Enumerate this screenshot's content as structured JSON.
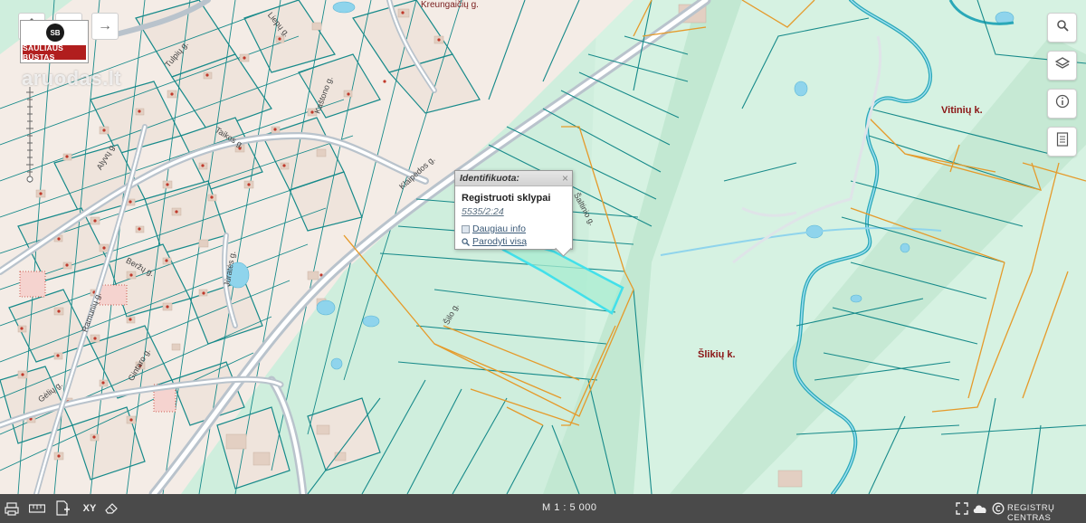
{
  "map": {
    "scale": "M 1 : 5 000",
    "colors": {
      "background": "#cfeedd",
      "parcel_line": "#178a8a",
      "registered_parcel": "#e59a2a",
      "road": "#b9c3cc",
      "water": "#8fd4ec",
      "building": "#e9d9cf",
      "highlight": "#6fe6e6"
    },
    "streets": [
      {
        "name": "Kreungaičių g."
      },
      {
        "name": "Taikos g."
      },
      {
        "name": "Klaipėdos g."
      },
      {
        "name": "Beržų g."
      },
      {
        "name": "Gintaro g."
      },
      {
        "name": "Gėlių g."
      },
      {
        "name": "Jūratės g."
      },
      {
        "name": "Kaštono g."
      },
      {
        "name": "Ramunių g."
      },
      {
        "name": "Alyvų g."
      },
      {
        "name": "Liepų g."
      },
      {
        "name": "Šilo g."
      },
      {
        "name": "Tulpių g."
      },
      {
        "name": "Šaltinio g."
      }
    ],
    "villages": [
      {
        "name": "Vitinių k."
      },
      {
        "name": "Šlikių k."
      }
    ]
  },
  "top_left": {
    "home_icon": "home-icon",
    "forward_icon": "arrow-right-icon",
    "logo_mark": "SB",
    "logo_text": "ŠAULIAUS BŪSTAS",
    "watermark": "aruodas.lt"
  },
  "right_toolbar": [
    {
      "icon": "search-icon"
    },
    {
      "icon": "layers-icon"
    },
    {
      "icon": "info-icon"
    },
    {
      "icon": "document-icon"
    }
  ],
  "popup": {
    "header": "Identifikuota:",
    "title": "Registruoti sklypai",
    "parcel_id": "5535/2:24",
    "more_info": "Daugiau info",
    "show_all": "Parodyti visą"
  },
  "bottom_bar": {
    "left_icons": [
      "print-icon",
      "measure-icon",
      "add-document-icon",
      "xy-coordinates-icon",
      "eraser-icon"
    ],
    "scale_label": "M 1 : 5 000",
    "right_icons": [
      "fullscreen-icon",
      "cloud-icon",
      "copyright-icon"
    ],
    "registry_label": "REGISTRŲ CENTRAS"
  }
}
